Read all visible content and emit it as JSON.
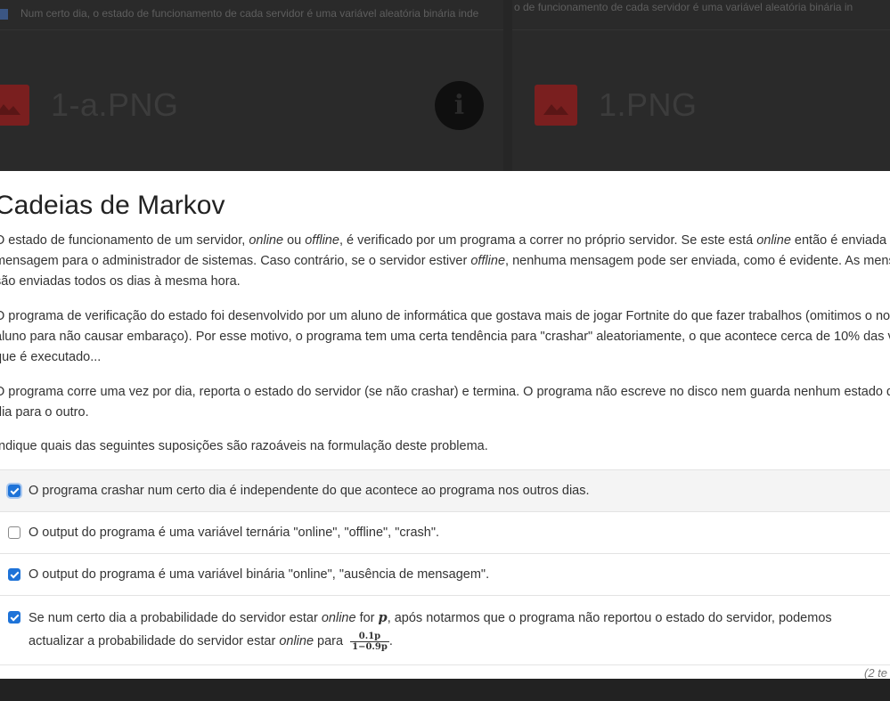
{
  "background": {
    "left_topline": "Num certo dia, o estado de funcionamento de cada servidor é uma variável aleatória binária inde",
    "right_topline": "o de funcionamento de cada servidor é uma variável aleatória binária in",
    "file_left": "1-a.PNG",
    "file_right": "1.PNG",
    "info_icon": "info-icon",
    "image_icon": "image-icon"
  },
  "modal": {
    "title": "Cadeias de Markov",
    "p1": {
      "a": "O estado de funcionamento de um servidor, ",
      "online1": "online",
      "b": " ou ",
      "offline1": "offline",
      "c": ", é verificado por um programa a correr no próprio servidor. Se este está ",
      "online2": "online",
      "d": " então é enviada uma mensagem para o administrador de sistemas. Caso contrário, se o servidor estiver ",
      "offline2": "offline",
      "e": ", nenhuma mensagem pode ser enviada, como é evidente. As mensagens são enviadas todos os dias à mesma hora."
    },
    "p2": "O programa de verificação do estado foi desenvolvido por um aluno de informática que gostava mais de jogar Fortnite do que fazer trabalhos (omitimos o nome do aluno para não causar embaraço). Por esse motivo, o programa tem uma certa tendência para \"crashar\" aleatoriamente, o que acontece cerca de 10% das vezes que é executado...",
    "p3": "O programa corre uma vez por dia, reporta o estado do servidor (se não crashar) e termina. O programa não escreve no disco nem guarda nenhum estado de um dia para o outro.",
    "p4": "Indique quais das seguintes suposições são razoáveis na formulação deste problema.",
    "options": [
      {
        "text": "O programa crashar num certo dia é independente do que acontece ao programa nos outros dias.",
        "checked": true
      },
      {
        "text": "O output do programa é uma variável ternária \"online\", \"offline\", \"crash\".",
        "checked": false
      },
      {
        "text": "O output do programa é uma variável binária \"online\", \"ausência de mensagem\".",
        "checked": true
      },
      {
        "a": "Se num certo dia a probabilidade do servidor estar ",
        "online1": "online",
        "b": " for ",
        "p": "p",
        "c": ", após notarmos que o programa não reportou o estado do servidor, podemos actualizar a probabilidade do servidor estar ",
        "online2": "online",
        "d": " para ",
        "frac_num": "0.1p",
        "frac_den": "1−0.9p",
        "e": ".",
        "checked": true
      }
    ],
    "attempts": "(2 te"
  },
  "colors": {
    "accent": "#1e73d8",
    "backdrop": "#262626",
    "file_icon": "#7a1f1f"
  }
}
